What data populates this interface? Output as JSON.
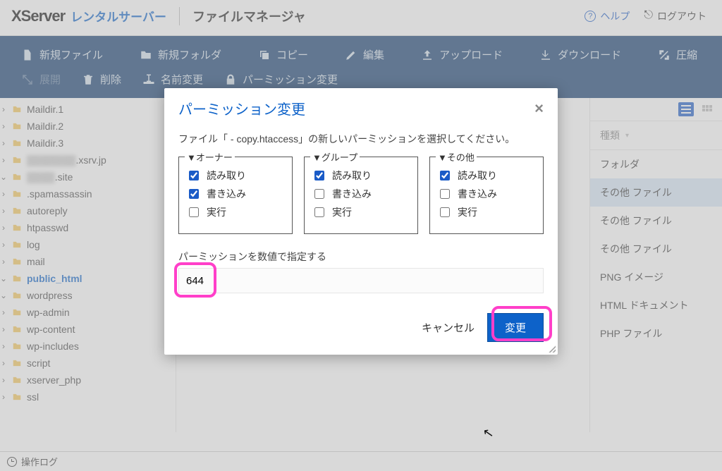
{
  "header": {
    "brand_main": "XServer",
    "brand_sub": "レンタルサーバー",
    "page_title": "ファイルマネージャ",
    "help_label": "ヘルプ",
    "logout_label": "ログアウト"
  },
  "toolbar": {
    "new_file": "新規ファイル",
    "new_folder": "新規フォルダ",
    "copy": "コピー",
    "edit": "編集",
    "upload": "アップロード",
    "download": "ダウンロード",
    "compress": "圧縮",
    "expand": "展開",
    "delete": "削除",
    "rename": "名前変更",
    "permission": "パーミッション変更"
  },
  "tree": {
    "items": [
      {
        "caret": "›",
        "label": "Maildir.1",
        "depth": 0
      },
      {
        "caret": "›",
        "label": "Maildir.2",
        "depth": 0
      },
      {
        "caret": "›",
        "label": "Maildir.3",
        "depth": 0
      },
      {
        "caret": "›",
        "label": ".xsrv.jp",
        "depth": 0,
        "blur": true,
        "prefix": "▒▒▒▒▒▒▒"
      },
      {
        "caret": "⌄",
        "label": ".site",
        "depth": 0,
        "blur": true,
        "prefix": "▒▒▒▒"
      },
      {
        "caret": "›",
        "label": ".spamassassin",
        "depth": 1
      },
      {
        "caret": "›",
        "label": "autoreply",
        "depth": 1
      },
      {
        "caret": "›",
        "label": "htpasswd",
        "depth": 1
      },
      {
        "caret": "›",
        "label": "log",
        "depth": 1
      },
      {
        "caret": "›",
        "label": "mail",
        "depth": 1
      },
      {
        "caret": "⌄",
        "label": "public_html",
        "depth": 1,
        "selected": true
      },
      {
        "caret": "⌄",
        "label": "wordpress",
        "depth": 2
      },
      {
        "caret": "›",
        "label": "wp-admin",
        "depth": 3
      },
      {
        "caret": "›",
        "label": "wp-content",
        "depth": 3
      },
      {
        "caret": "›",
        "label": "wp-includes",
        "depth": 3
      },
      {
        "caret": "›",
        "label": "script",
        "depth": 1
      },
      {
        "caret": "›",
        "label": "xserver_php",
        "depth": 1
      },
      {
        "caret": "›",
        "label": "ssl",
        "depth": 0
      }
    ]
  },
  "right": {
    "column_header": "種類",
    "rows": [
      {
        "label": "フォルダ"
      },
      {
        "label": "その他 ファイル",
        "highlight": true
      },
      {
        "label": "その他 ファイル"
      },
      {
        "label": "その他 ファイル"
      },
      {
        "label": "PNG イメージ"
      },
      {
        "label": "HTML ドキュメント"
      },
      {
        "label": "PHP ファイル"
      }
    ]
  },
  "footer": {
    "log_label": "操作ログ"
  },
  "modal": {
    "title": "パーミッション変更",
    "description": "ファイル「 - copy.htaccess」の新しいパーミッションを選択してください。",
    "groups": {
      "owner": {
        "legend": "▼オーナー",
        "read": "読み取り",
        "write": "書き込み",
        "exec": "実行",
        "r": true,
        "w": true,
        "x": false
      },
      "group": {
        "legend": "▼グループ",
        "read": "読み取り",
        "write": "書き込み",
        "exec": "実行",
        "r": true,
        "w": false,
        "x": false
      },
      "other": {
        "legend": "▼その他",
        "read": "読み取り",
        "write": "書き込み",
        "exec": "実行",
        "r": true,
        "w": false,
        "x": false
      }
    },
    "numeric_label": "パーミッションを数値で指定する",
    "numeric_value": "644",
    "cancel": "キャンセル",
    "submit": "変更"
  }
}
